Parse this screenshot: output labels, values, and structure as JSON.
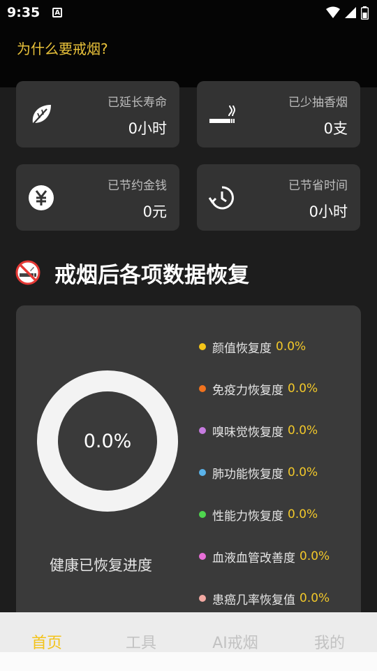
{
  "status_bar": {
    "time": "9:35",
    "notification_letter": "A"
  },
  "header": {
    "why_quit_link": "为什么要戒烟?"
  },
  "stats": [
    {
      "label": "已延长寿命",
      "value": "0小时",
      "icon": "leaf-icon"
    },
    {
      "label": "已少抽香烟",
      "value": "0支",
      "icon": "cigarette-icon"
    },
    {
      "label": "已节约金钱",
      "value": "0元",
      "icon": "yen-icon"
    },
    {
      "label": "已节省时间",
      "value": "0小时",
      "icon": "timer-icon"
    }
  ],
  "section": {
    "title": "戒烟后各项数据恢复",
    "icon": "no-smoking-icon"
  },
  "recovery": {
    "overall_percent": "0.0%",
    "overall_value": 0.0,
    "overall_label": "健康已恢复进度",
    "metrics": [
      {
        "name": "颜值恢复度",
        "value": "0.0%",
        "color": "#f5c518"
      },
      {
        "name": "免疫力恢复度",
        "value": "0.0%",
        "color": "#f0721e"
      },
      {
        "name": "嗅味觉恢复度",
        "value": "0.0%",
        "color": "#c67be0"
      },
      {
        "name": "肺功能恢复度",
        "value": "0.0%",
        "color": "#5ab3ea"
      },
      {
        "name": "性能力恢复度",
        "value": "0.0%",
        "color": "#4fd64f"
      },
      {
        "name": "血液血管改善度",
        "value": "0.0%",
        "color": "#e86fd8"
      },
      {
        "name": "患癌几率恢复值",
        "value": "0.0%",
        "color": "#f2a9a2"
      }
    ]
  },
  "tabbar": {
    "tabs": [
      {
        "label": "首页",
        "active": true
      },
      {
        "label": "工具",
        "active": false
      },
      {
        "label": "AI戒烟",
        "active": false
      },
      {
        "label": "我的",
        "active": false
      }
    ]
  },
  "colors": {
    "accent": "#f3c31a",
    "card_bg": "#333333",
    "page_bg": "#151515"
  }
}
